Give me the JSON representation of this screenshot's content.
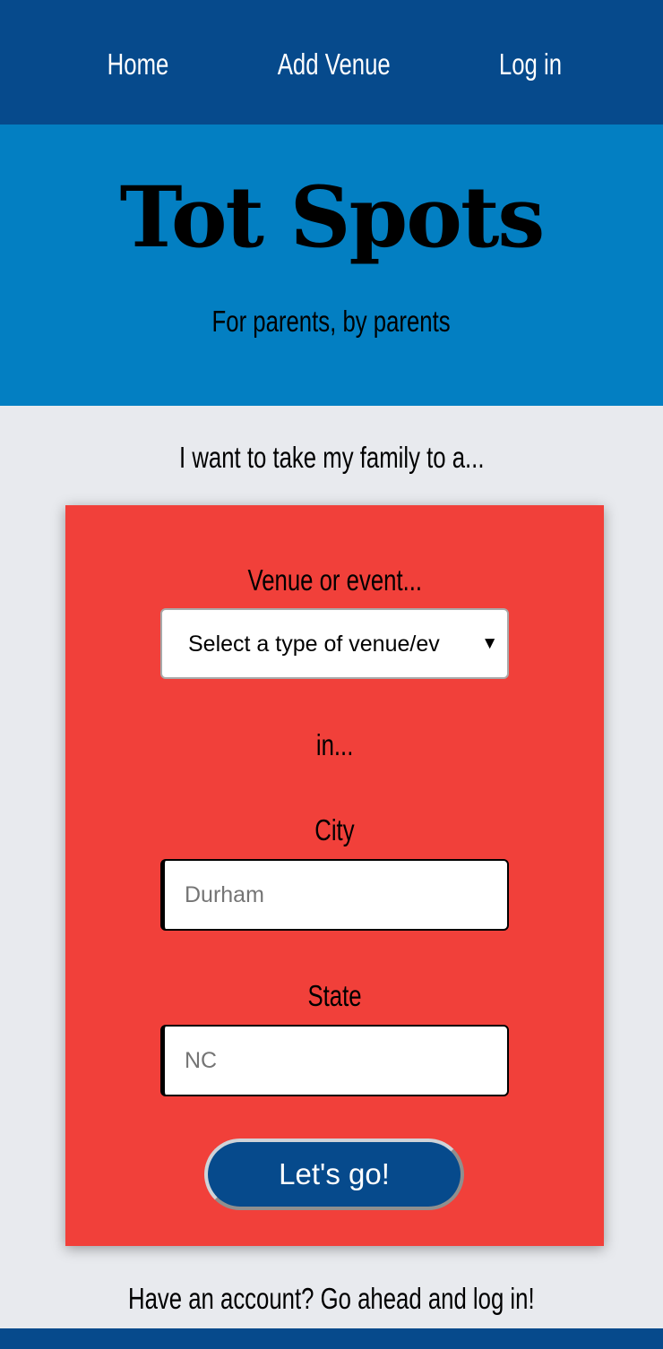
{
  "nav": {
    "home_label": "Home",
    "add_venue_label": "Add Venue",
    "login_label": "Log in"
  },
  "hero": {
    "title": "Tot Spots",
    "tagline": "For parents, by parents"
  },
  "search": {
    "intro": "I want to take my family to a...",
    "venue_label": "Venue or event...",
    "venue_select_value": "Select a type of venue/ev",
    "in_label": "in...",
    "city_label": "City",
    "city_placeholder": "Durham",
    "state_label": "State",
    "state_placeholder": "NC",
    "submit_label": "Let's go!"
  },
  "footer": {
    "login_prompt": "Have an account? Go ahead and log in!"
  },
  "colors": {
    "nav_bg": "#064a8c",
    "hero_bg": "#037fc2",
    "page_bg": "#e8eaee",
    "card_bg": "#f1403a",
    "button_bg": "#064a8c"
  },
  "icons": {
    "select_arrow": "dropdown-triangle-icon"
  }
}
